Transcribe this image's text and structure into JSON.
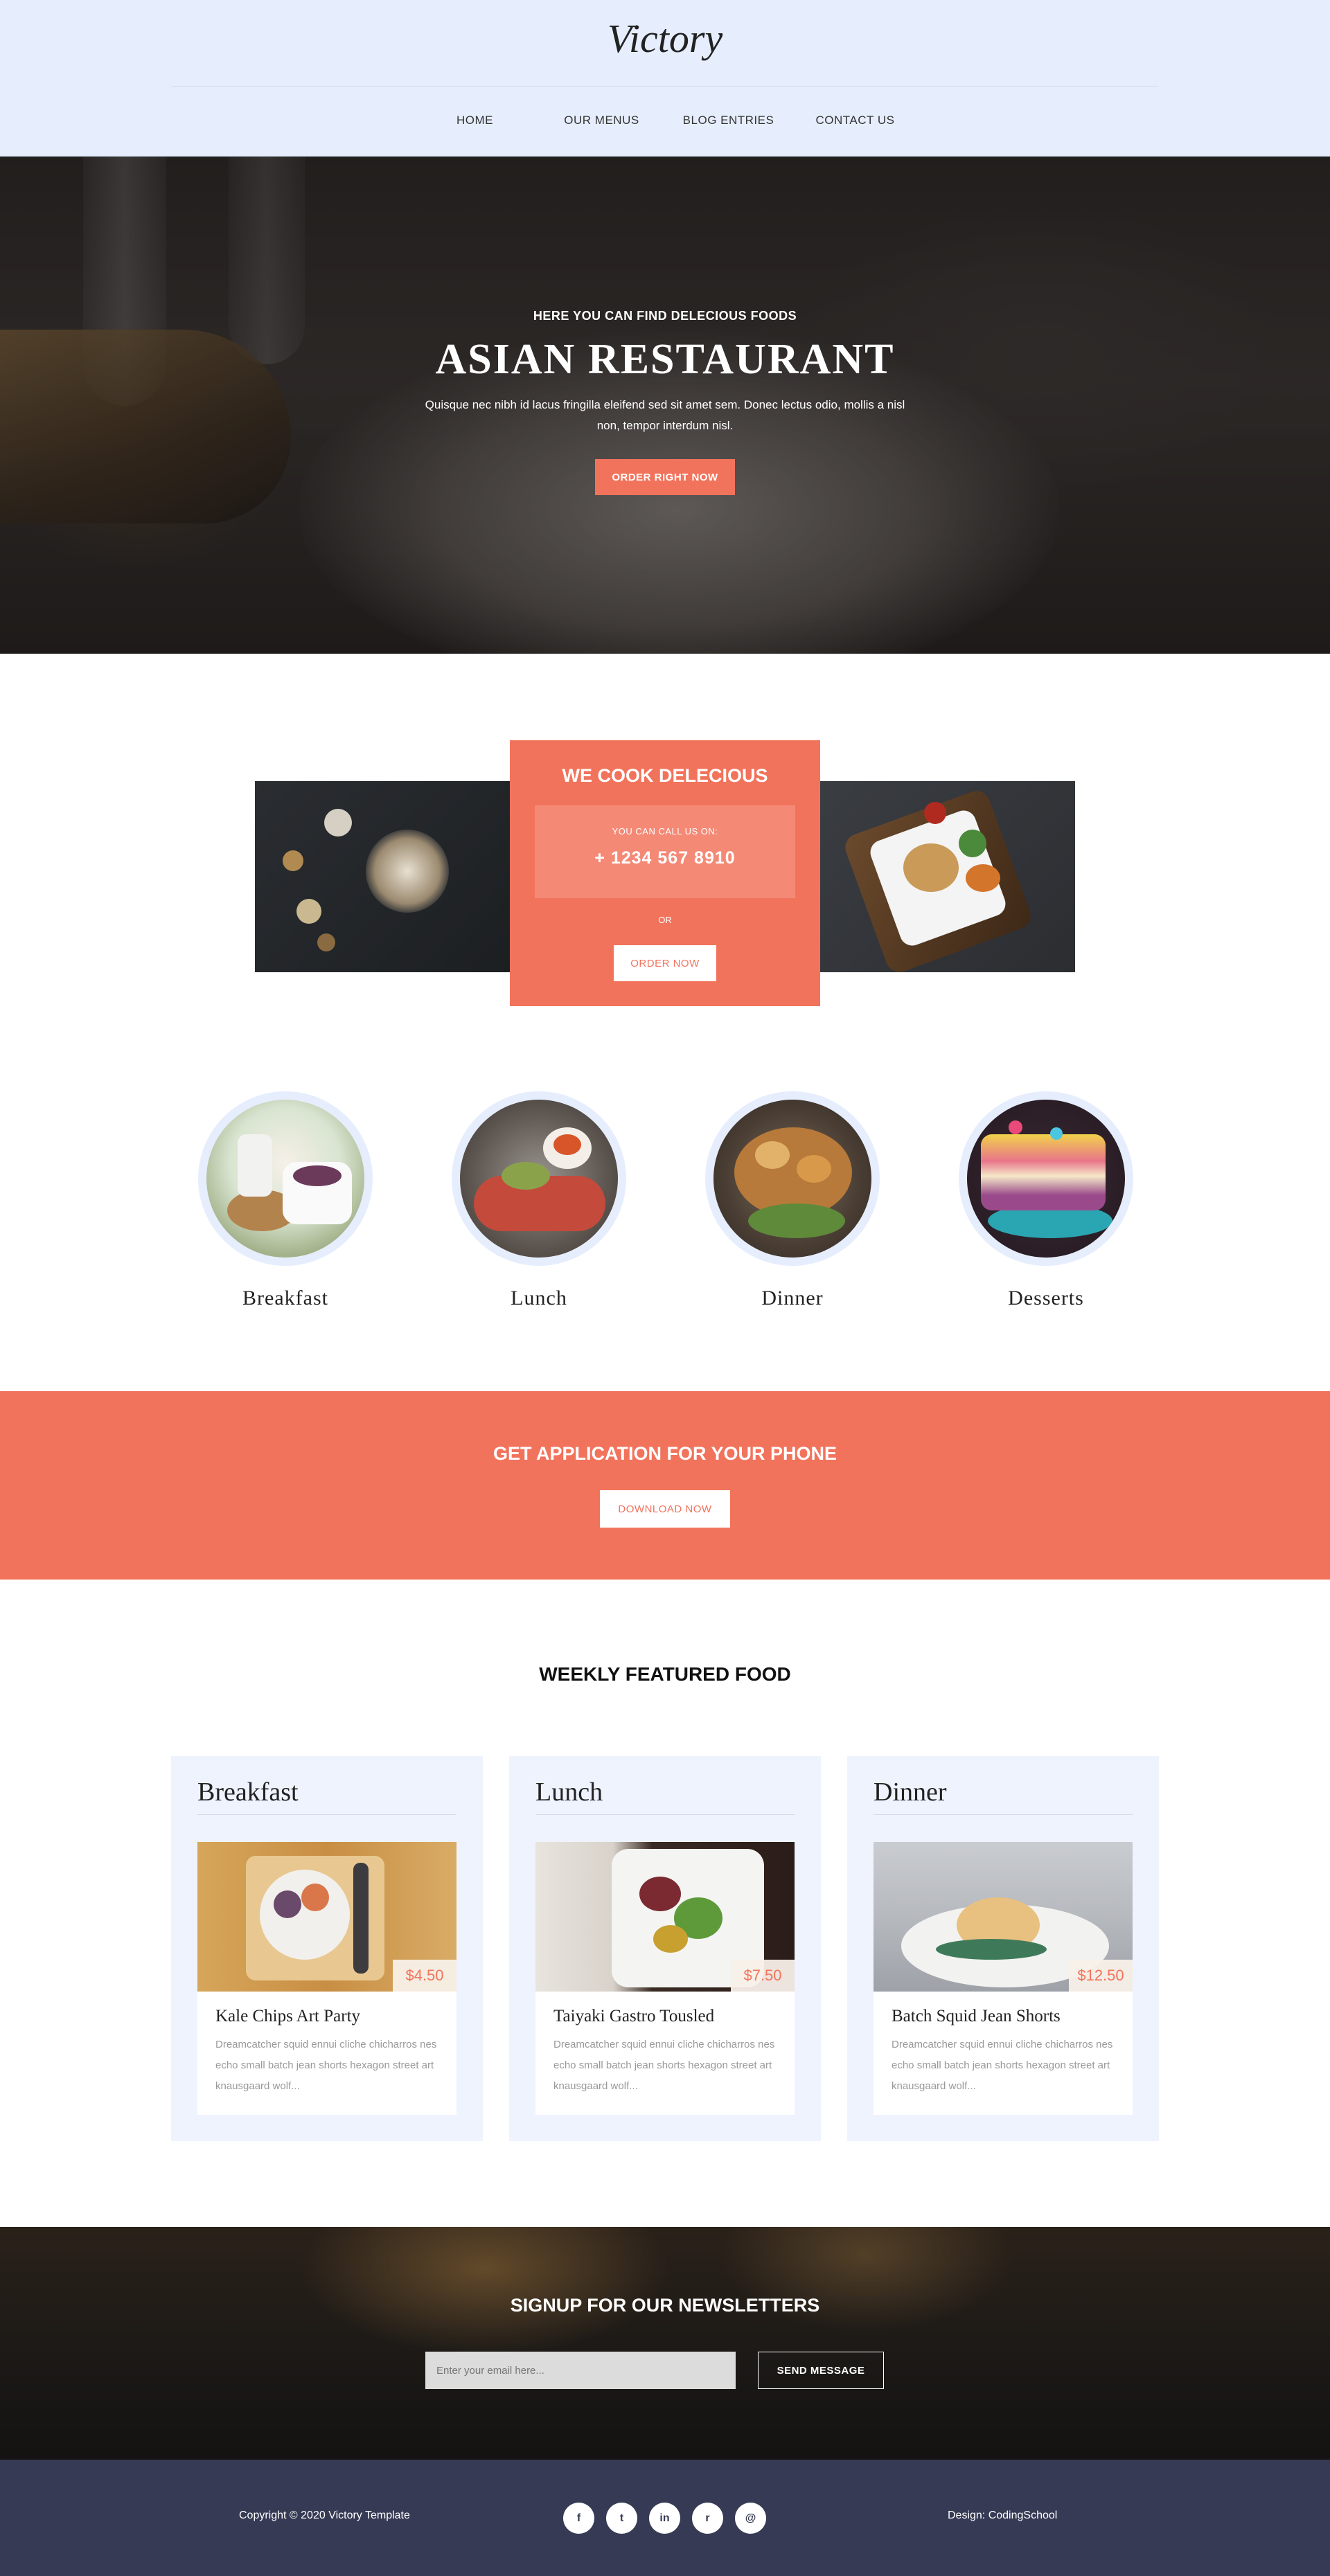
{
  "header": {
    "logo": "Victory",
    "nav": [
      "HOME",
      "OUR MENUS",
      "BLOG ENTRIES",
      "CONTACT US"
    ]
  },
  "hero": {
    "subtitle": "HERE YOU CAN FIND DELECIOUS FOODS",
    "title": "ASIAN RESTAURANT",
    "description": "Quisque nec nibh id lacus fringilla eleifend sed sit amet sem. Donec lectus odio, mollis a nisl non, tempor interdum nisl.",
    "button": "ORDER RIGHT NOW"
  },
  "cook": {
    "title": "WE COOK DELECIOUS",
    "call_label": "YOU CAN CALL US ON:",
    "phone": "+ 1234 567 8910",
    "or": "OR",
    "button": "ORDER NOW"
  },
  "categories": [
    "Breakfast",
    "Lunch",
    "Dinner",
    "Desserts"
  ],
  "app": {
    "title": "GET APPLICATION FOR YOUR PHONE",
    "button": "DOWNLOAD NOW"
  },
  "weekly": {
    "title": "WEEKLY FEATURED FOOD",
    "cards": [
      {
        "heading": "Breakfast",
        "price": "$4.50",
        "name": "Kale Chips Art Party",
        "desc": "Dreamcatcher squid ennui cliche chicharros nes echo small batch jean shorts hexagon street art knausgaard wolf..."
      },
      {
        "heading": "Lunch",
        "price": "$7.50",
        "name": "Taiyaki Gastro Tousled",
        "desc": "Dreamcatcher squid ennui cliche chicharros nes echo small batch jean shorts hexagon street art knausgaard wolf..."
      },
      {
        "heading": "Dinner",
        "price": "$12.50",
        "name": "Batch Squid Jean Shorts",
        "desc": "Dreamcatcher squid ennui cliche chicharros nes echo small batch jean shorts hexagon street art knausgaard wolf..."
      }
    ]
  },
  "newsletter": {
    "title": "SIGNUP FOR OUR NEWSLETTERS",
    "placeholder": "Enter your email here...",
    "button": "SEND MESSAGE"
  },
  "footer": {
    "copyright": "Copyright © 2020 Victory Template",
    "design": "Design: CodingSchool",
    "social": [
      {
        "icon": "facebook-icon",
        "glyph": "f"
      },
      {
        "icon": "twitter-icon",
        "glyph": "t"
      },
      {
        "icon": "linkedin-icon",
        "glyph": "in"
      },
      {
        "icon": "rss-icon",
        "glyph": "r"
      },
      {
        "icon": "dribbble-icon",
        "glyph": "@"
      }
    ]
  },
  "colors": {
    "accent": "#f2735c",
    "header_bg": "#e6eefd",
    "footer_bg": "#363a54"
  }
}
